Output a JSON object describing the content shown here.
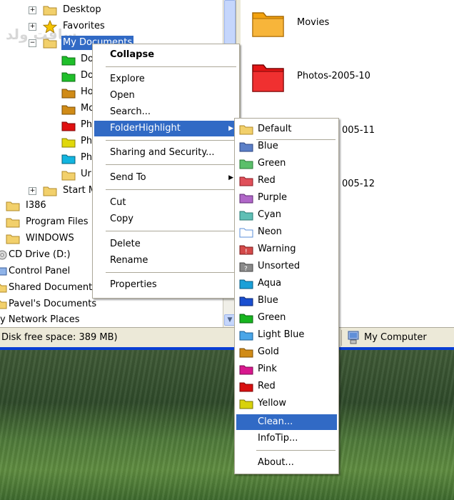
{
  "tree": {
    "items": [
      {
        "label": "Desktop",
        "color": "#f2d06b"
      },
      {
        "label": "Favorites",
        "color": "#f5c400"
      },
      {
        "label": "My Documents",
        "color": "#f2d06b"
      },
      {
        "label": "Do",
        "color": "#1fbf2a"
      },
      {
        "label": "Do",
        "color": "#1fbf2a"
      },
      {
        "label": "Ho",
        "color": "#d08b17"
      },
      {
        "label": "Mo",
        "color": "#d08b17"
      },
      {
        "label": "Ph",
        "color": "#e01010"
      },
      {
        "label": "Ph",
        "color": "#e0d80a"
      },
      {
        "label": "Ph",
        "color": "#12b5e0"
      },
      {
        "label": "Ur",
        "color": "#f2d06b"
      },
      {
        "label": "Start M",
        "color": "#f2d06b"
      },
      {
        "label": "I386",
        "color": "#f2d06b"
      },
      {
        "label": "Program Files",
        "color": "#f2d06b"
      },
      {
        "label": "WINDOWS",
        "color": "#f2d06b"
      },
      {
        "label": "CD Drive (D:)"
      },
      {
        "label": "Control Panel"
      },
      {
        "label": "Shared Documents"
      },
      {
        "label": "Pavel's Documents"
      },
      {
        "label": "y Network Places"
      }
    ]
  },
  "files": {
    "items": [
      {
        "label": "Movies",
        "color": "#f3a20e"
      },
      {
        "label": "Photos-2005-10",
        "color": "#e41515"
      },
      {
        "label": "005-11",
        "color": "#e0d80a"
      },
      {
        "label": "005-12",
        "color": "#e0d80a"
      }
    ]
  },
  "status": {
    "free_space": "Disk free space: 389 MB)",
    "location": "My Computer"
  },
  "watermark": "سافت ولد",
  "context_menu": {
    "collapse": "Collapse",
    "explore": "Explore",
    "open": "Open",
    "search": "Search...",
    "folder_highlight": "FolderHighlight",
    "sharing": "Sharing and Security...",
    "send_to": "Send To",
    "cut": "Cut",
    "copy": "Copy",
    "delete": "Delete",
    "rename": "Rename",
    "properties": "Properties"
  },
  "submenu": {
    "items": [
      {
        "label": "Default",
        "color": "#f2d06b"
      },
      {
        "label": "Blue",
        "color": "#5b7fc7"
      },
      {
        "label": "Green",
        "color": "#5bbf6a"
      },
      {
        "label": "Red",
        "color": "#e0505a"
      },
      {
        "label": "Purple",
        "color": "#b067c8"
      },
      {
        "label": "Cyan",
        "color": "#5fbfb5"
      },
      {
        "label": "Neon",
        "color": "#ffffff"
      },
      {
        "label": "Warning",
        "color": "#d44a4a"
      },
      {
        "label": "Unsorted",
        "color": "#8a8a8a"
      },
      {
        "label": "Aqua",
        "color": "#1aa0d8"
      },
      {
        "label": "Blue",
        "color": "#1a4fd0"
      },
      {
        "label": "Green",
        "color": "#17b51f"
      },
      {
        "label": "Light Blue",
        "color": "#4aa6e8"
      },
      {
        "label": "Gold",
        "color": "#d08b17"
      },
      {
        "label": "Pink",
        "color": "#d8188e"
      },
      {
        "label": "Red",
        "color": "#d81010"
      },
      {
        "label": "Yellow",
        "color": "#d8d20a"
      }
    ],
    "clean": "Clean...",
    "infotip": "InfoTip...",
    "about": "About..."
  }
}
